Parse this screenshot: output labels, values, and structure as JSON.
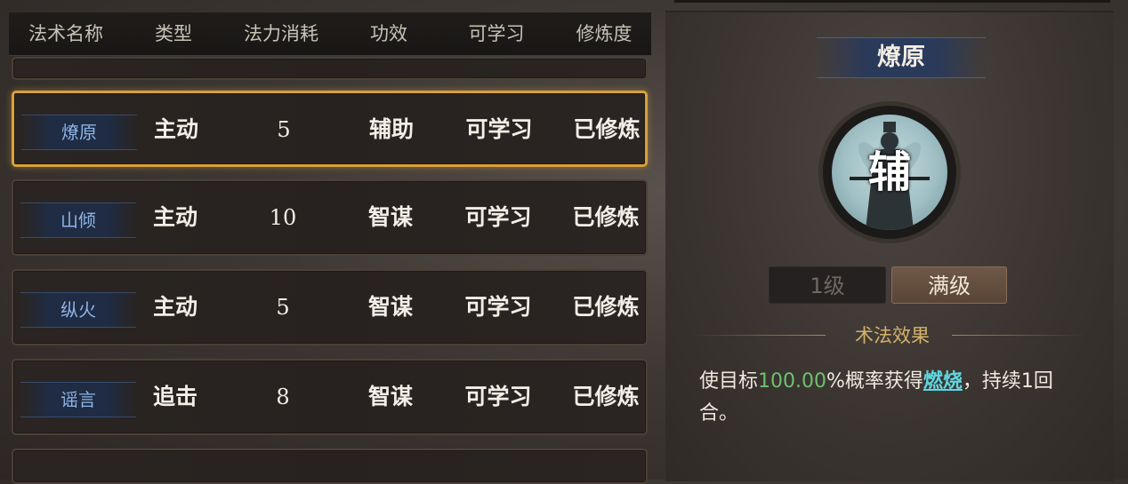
{
  "table": {
    "headers": [
      "法术名称",
      "类型",
      "法力消耗",
      "功效",
      "可学习",
      "修炼度"
    ],
    "rows": [
      {
        "name": "燎原",
        "type": "主动",
        "cost": "5",
        "effect": "辅助",
        "learnable": "可学习",
        "progress": "已修炼"
      },
      {
        "name": "山倾",
        "type": "主动",
        "cost": "10",
        "effect": "智谋",
        "learnable": "可学习",
        "progress": "已修炼"
      },
      {
        "name": "纵火",
        "type": "主动",
        "cost": "5",
        "effect": "智谋",
        "learnable": "可学习",
        "progress": "已修炼"
      },
      {
        "name": "谣言",
        "type": "追击",
        "cost": "8",
        "effect": "智谋",
        "learnable": "可学习",
        "progress": "已修炼"
      }
    ]
  },
  "detail": {
    "title": "燎原",
    "portrait_char": "辅",
    "level_1": "1级",
    "level_max": "满级",
    "effect_heading": "术法效果",
    "effect_pre": "使目标",
    "effect_value": "100.00",
    "effect_mid": "%概率获得",
    "effect_keyword": "燃烧",
    "effect_post": "，持续1回合。"
  }
}
